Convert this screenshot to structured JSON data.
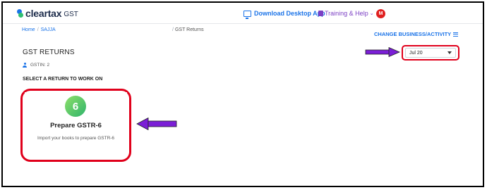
{
  "header": {
    "logo_text": "cleartax",
    "logo_sub": "GST",
    "download_label": "Download Desktop App",
    "training_label": "Training & Help",
    "training_chevron": "⌄",
    "avatar_initial": "M"
  },
  "breadcrumb": {
    "home": "Home",
    "separator": "/",
    "business": "SAJJA",
    "page": "GST Returns"
  },
  "change_business_label": "CHANGE BUSINESS/ACTIVITY",
  "page_title": "GST RETURNS",
  "gstin_label": "GSTIN: 2",
  "section_label": "SELECT A RETURN TO WORK ON",
  "period_select": {
    "value": "Jul 20"
  },
  "return_card": {
    "number": "6",
    "title": "Prepare GSTR-6",
    "description": "Import your books to prepare GSTR-6"
  },
  "colors": {
    "accent": "#1a73e8",
    "highlight": "#e0001b",
    "arrow": "#7b1fd6",
    "training": "#7b3fc4"
  },
  "icons": {
    "logo": "cleartax-logo-icon",
    "download": "monitor-icon",
    "training": "graduation-cap-icon",
    "menu": "hamburger-icon",
    "gstin": "user-icon",
    "dropdown": "chevron-down-icon"
  }
}
